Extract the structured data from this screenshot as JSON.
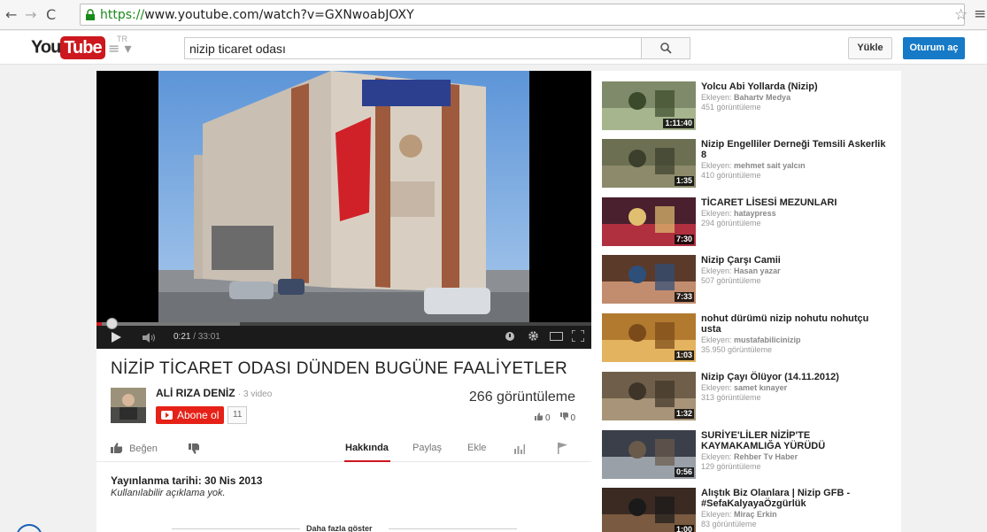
{
  "browser": {
    "url_protocol": "https://",
    "url_rest": "www.youtube.com/watch?v=GXNwoabJOXY"
  },
  "header": {
    "logo_you": "You",
    "logo_tube": "Tube",
    "logo_region": "TR",
    "search_value": "nizip ticaret odası",
    "upload_label": "Yükle",
    "signin_label": "Oturum aç"
  },
  "player": {
    "current_time": "0:21",
    "duration": "/ 33:01",
    "played_fraction": 0.011,
    "buffered_fraction": 0.29
  },
  "video": {
    "title": "NİZİP TİCARET ODASI DÜNDEN BUGÜNE FAALİYETLER",
    "channel": "ALİ RIZA DENİZ",
    "video_count": "· 3 video",
    "subscribe_label": "Abone ol",
    "subscriber_count": "11",
    "views": "266 görüntüleme",
    "like_count": "0",
    "dislike_count": "0",
    "published": "Yayınlanma tarihi: 30 Nis 2013",
    "description": "Kullanılabilir açıklama yok.",
    "show_more": "Daha fazla göster"
  },
  "actions": {
    "like": "Beğen",
    "about": "Hakkında",
    "share": "Paylaş",
    "add": "Ekle"
  },
  "related": [
    {
      "title": "Yolcu Abi Yollarda (Nizip)",
      "by_label": "Ekleyen:",
      "by": "Bahartv Medya",
      "views": "451 görüntüleme",
      "duration": "1:11:40"
    },
    {
      "title": "Nizip Engelliler Derneği Temsili Askerlik 8",
      "by_label": "Ekleyen:",
      "by": "mehmet sait yalcın",
      "views": "410 görüntüleme",
      "duration": "1:35"
    },
    {
      "title": "TİCARET LİSESİ MEZUNLARI",
      "by_label": "Ekleyen:",
      "by": "hataypress",
      "views": "294 görüntüleme",
      "duration": "7:30"
    },
    {
      "title": "Nizip Çarşı Camii",
      "by_label": "Ekleyen:",
      "by": "Hasan yazar",
      "views": "507 görüntüleme",
      "duration": "7:33"
    },
    {
      "title": "nohut dürümü nizip nohutu nohutçu usta",
      "by_label": "Ekleyen:",
      "by": "mustafabilicinizip",
      "views": "35.950 görüntüleme",
      "duration": "1:03"
    },
    {
      "title": "Nizip Çayı Ölüyor (14.11.2012)",
      "by_label": "Ekleyen:",
      "by": "samet kınayer",
      "views": "313 görüntüleme",
      "duration": "1:32"
    },
    {
      "title": "SURİYE'LİLER NİZİP'TE KAYMAKAMLIĞA YÜRÜDÜ",
      "by_label": "Ekleyen:",
      "by": "Rehber Tv Haber",
      "views": "129 görüntüleme",
      "duration": "0:56"
    },
    {
      "title": "Alıştık Biz Olanlara | Nizip GFB - #SefaKalyayaÖzgürlük",
      "by_label": "Ekleyen:",
      "by": "Miraç Erkin",
      "views": "83 görüntüleme",
      "duration": "1:00"
    }
  ]
}
